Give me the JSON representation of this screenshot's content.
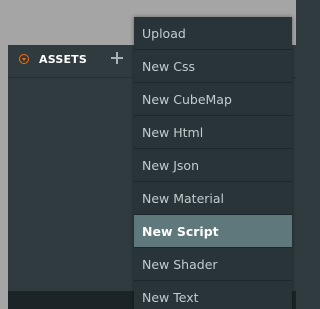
{
  "panel": {
    "title": "ASSETS"
  },
  "menu": {
    "items": [
      {
        "label": "Upload"
      },
      {
        "label": "New Css"
      },
      {
        "label": "New CubeMap"
      },
      {
        "label": "New Html"
      },
      {
        "label": "New Json"
      },
      {
        "label": "New Material"
      },
      {
        "label": "New Script"
      },
      {
        "label": "New Shader"
      },
      {
        "label": "New Text"
      }
    ],
    "highlighted_label": "New Script"
  },
  "colors": {
    "accent": "#ff6a00",
    "panel_bg": "#2f3b3f",
    "menu_bg": "#283438",
    "menu_highlight": "#5f787c",
    "window_bg": "#a5a5a5"
  },
  "icons": {
    "collapse": "circle-chevron-down-icon",
    "add": "plus-icon"
  }
}
